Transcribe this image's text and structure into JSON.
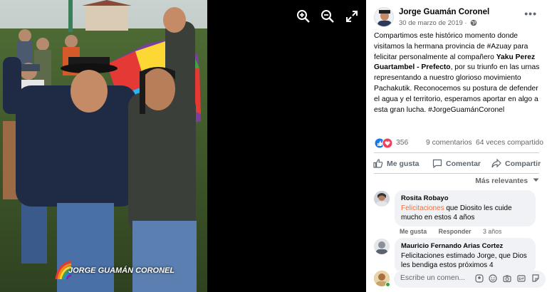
{
  "viewer": {
    "overlay_text": "JORGE GUAMÁN CORONEL",
    "zoom_in_icon": "zoom-in-icon",
    "zoom_out_icon": "zoom-out-icon",
    "fullscreen_icon": "fullscreen-icon"
  },
  "post": {
    "author": "Jorge Guamán Coronel",
    "date": "30 de marzo de 2019 ·",
    "text_intro": "Compartimos este histórico momento donde visitamos la hermana provincia de #Azuay para felicitar personalmente al compañero ",
    "text_bold": "Yaku Perez Guartambel - Prefecto",
    "text_rest": ", por su triunfo en las urnas representando a nuestro glorioso movimiento Pachakutik. Reconocemos su postura de defender el agua y el territorio, esperamos aportar en algo a esta gran lucha.",
    "hashtag": "#JorgeGuamánCoronel",
    "reactions": "356",
    "comments": "9 comentarios",
    "shares": "64 veces compartido",
    "colors": {
      "like": "#1877f2",
      "love": "#f33e58"
    }
  },
  "actions": {
    "like": "Me gusta",
    "comment": "Comentar",
    "share": "Compartir"
  },
  "comments_filter": "Más relevantes",
  "comments": [
    {
      "name": "Rosita Robayo",
      "highlight": "Felicitaciones",
      "text": " que Diosito les cuide mucho en estos 4 años",
      "like": "Me gusta",
      "reply": "Responder",
      "age": "3 años"
    },
    {
      "name": "Mauricio Fernando Arias Cortez",
      "text": "Felicitaciones estimado Jorge, que Dios les bendiga estos próximos 4"
    }
  ],
  "composer": {
    "placeholder": "Escribe un comen..."
  }
}
